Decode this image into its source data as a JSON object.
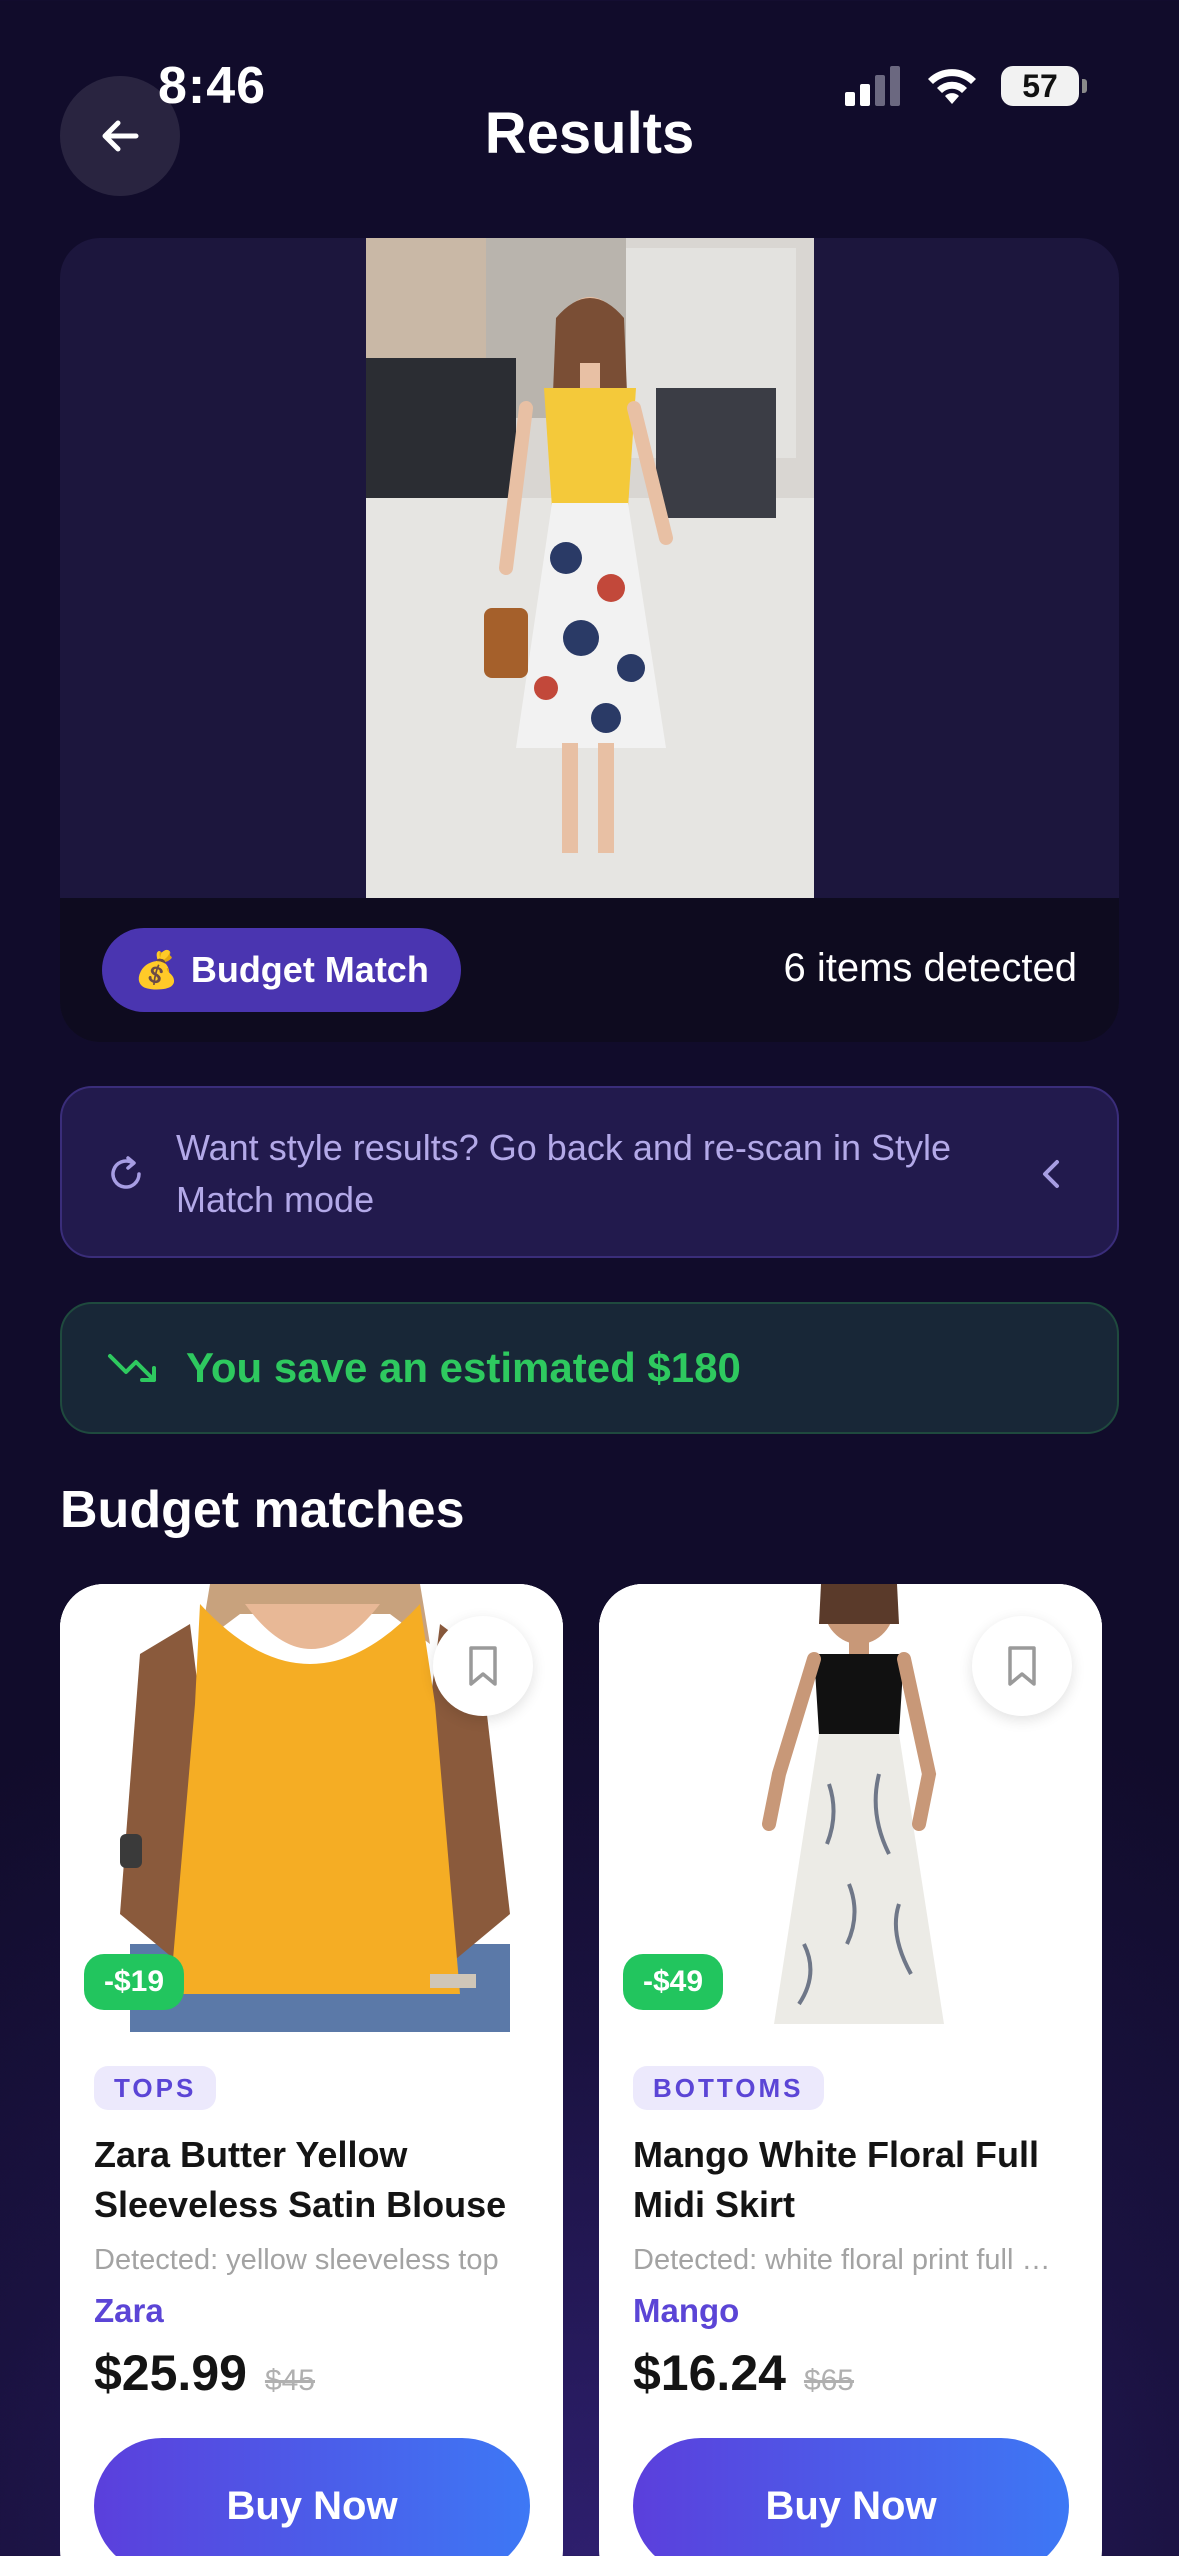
{
  "status_bar": {
    "time": "8:46",
    "battery": "57"
  },
  "header": {
    "title": "Results"
  },
  "scan": {
    "mode_emoji": "💰",
    "mode_label": "Budget Match",
    "items_detected": "6 items detected"
  },
  "info_banner": {
    "text": "Want style results? Go back and re-scan in Style Match mode"
  },
  "savings": {
    "text": "You save an estimated $180"
  },
  "section": {
    "title": "Budget matches"
  },
  "products": [
    {
      "discount": "-$19",
      "category": "TOPS",
      "name": "Zara Butter Yellow Sleeveless Satin Blouse",
      "detected": "Detected: yellow sleeveless top",
      "brand": "Zara",
      "price": "$25.99",
      "old_price": "$45",
      "buy_label": "Buy Now"
    },
    {
      "discount": "-$49",
      "category": "BOTTOMS",
      "name": "Mango White Floral Full Midi Skirt",
      "detected": "Detected: white floral print full midi skirt",
      "brand": "Mango",
      "price": "$16.24",
      "old_price": "$65",
      "buy_label": "Buy Now"
    }
  ],
  "icons": {
    "back": "arrow-left-icon",
    "bookmark": "bookmark-icon",
    "refresh": "refresh-icon",
    "chevron": "chevron-left-icon",
    "trend": "trend-down-icon"
  },
  "colors": {
    "accent": "#5b45d6",
    "savings_green": "#2ec95f",
    "discount_green": "#22c55e",
    "button_gradient_start": "#5b3fdc",
    "button_gradient_end": "#3d78f5"
  }
}
